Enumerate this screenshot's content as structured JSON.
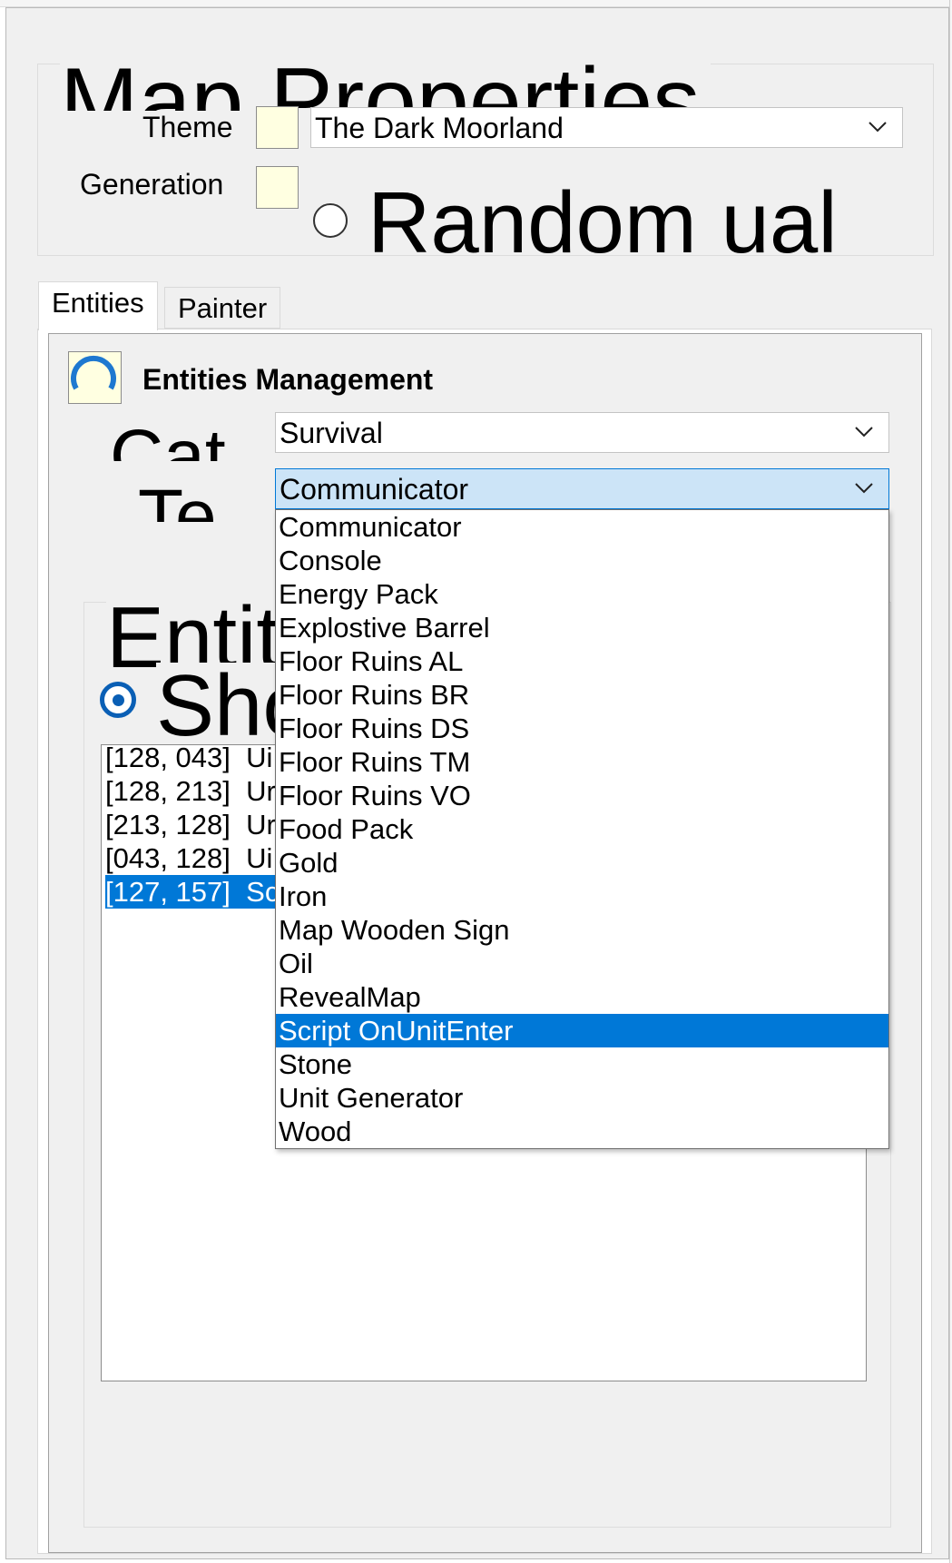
{
  "map_properties": {
    "title": "Map Properties",
    "theme_label": "Theme",
    "theme_value": "The Dark Moorland",
    "generation_label": "Generation",
    "generation_option": "Random ual"
  },
  "tabs": [
    {
      "label": "Entities"
    },
    {
      "label": "Painter"
    }
  ],
  "entities_management": {
    "title": "Entities Management",
    "category_label_fragment": "Cat",
    "type_label_fragment": "Te",
    "category_value": "Survival",
    "type_value": "Communicator",
    "entities_label_fragment": "Entit",
    "show_label_fragment": "Sho"
  },
  "entity_list": [
    {
      "coords": "[128, 043]",
      "name": "Ui",
      "selected": false
    },
    {
      "coords": "[128, 213]",
      "name": "Ur",
      "selected": false
    },
    {
      "coords": "[213, 128]",
      "name": "Ur",
      "selected": false
    },
    {
      "coords": "[043, 128]",
      "name": "Ui",
      "selected": false
    },
    {
      "coords": "[127, 157]",
      "name": "Sc",
      "selected": true
    }
  ],
  "type_dropdown": {
    "highlighted": "Script OnUnitEnter",
    "options": [
      "Communicator",
      "Console",
      "Energy Pack",
      "Explostive Barrel",
      "Floor Ruins AL",
      "Floor Ruins BR",
      "Floor Ruins DS",
      "Floor Ruins TM",
      "Floor Ruins VO",
      "Food Pack",
      "Gold",
      "Iron",
      "Map Wooden Sign",
      "Oil",
      "RevealMap",
      "Script OnUnitEnter",
      "Stone",
      "Unit Generator",
      "Wood"
    ]
  },
  "colors": {
    "window_bg": "#f0f0f0",
    "selection": "#0078d7",
    "swatch": "#ffffe1",
    "focused_combo": "#cce4f7"
  }
}
